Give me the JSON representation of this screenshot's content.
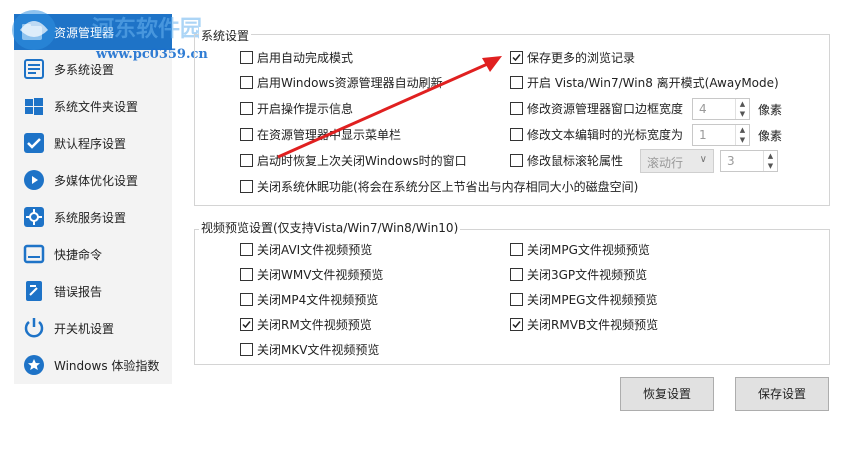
{
  "sidebar": {
    "items": [
      {
        "label": "资源管理器",
        "icon": "folder-icon"
      },
      {
        "label": "多系统设置",
        "icon": "multi-system-icon"
      },
      {
        "label": "系统文件夹设置",
        "icon": "windows-folder-icon"
      },
      {
        "label": "默认程序设置",
        "icon": "checkmark-icon"
      },
      {
        "label": "多媒体优化设置",
        "icon": "media-icon"
      },
      {
        "label": "系统服务设置",
        "icon": "service-icon"
      },
      {
        "label": "快捷命令",
        "icon": "shortcut-icon"
      },
      {
        "label": "错误报告",
        "icon": "error-report-icon"
      },
      {
        "label": "开关机设置",
        "icon": "power-icon"
      },
      {
        "label": "Windows 体验指数",
        "icon": "star-icon"
      }
    ]
  },
  "watermark": {
    "brand": "河东软件园",
    "url": "www.pc0359.cn"
  },
  "system_settings": {
    "title": "系统设置",
    "left_options": [
      {
        "label": "启用自动完成模式",
        "checked": false
      },
      {
        "label": "启用Windows资源管理器自动刷新",
        "checked": false
      },
      {
        "label": "开启操作提示信息",
        "checked": false
      },
      {
        "label": "在资源管理器中显示菜单栏",
        "checked": false
      },
      {
        "label": "启动时恢复上次关闭Windows时的窗口",
        "checked": false
      }
    ],
    "right_options": [
      {
        "label": "保存更多的浏览记录",
        "checked": true
      },
      {
        "label": "开启 Vista/Win7/Win8 离开模式(AwayMode)",
        "checked": false
      },
      {
        "label": "修改资源管理器窗口边框宽度",
        "checked": false
      },
      {
        "label": "修改文本编辑时的光标宽度为",
        "checked": false
      },
      {
        "label": "修改鼠标滚轮属性",
        "checked": false
      }
    ],
    "full_option": {
      "label": "关闭系统休眠功能(将会在系统分区上节省出与内存相同大小的磁盘空间)",
      "checked": false
    },
    "border_width": {
      "value": "4",
      "unit": "像素"
    },
    "cursor_width": {
      "value": "1",
      "unit": "像素"
    },
    "wheel_mode": {
      "value": "滚动行"
    },
    "wheel_lines": {
      "value": "3"
    }
  },
  "video_preview": {
    "title": "视频预览设置(仅支持Vista/Win7/Win8/Win10)",
    "left_options": [
      {
        "label": "关闭AVI文件视频预览",
        "checked": false
      },
      {
        "label": "关闭WMV文件视频预览",
        "checked": false
      },
      {
        "label": "关闭MP4文件视频预览",
        "checked": false
      },
      {
        "label": "关闭RM文件视频预览",
        "checked": true
      },
      {
        "label": "关闭MKV文件视频预览",
        "checked": false
      }
    ],
    "right_options": [
      {
        "label": "关闭MPG文件视频预览",
        "checked": false
      },
      {
        "label": "关闭3GP文件视频预览",
        "checked": false
      },
      {
        "label": "关闭MPEG文件视频预览",
        "checked": false
      },
      {
        "label": "关闭RMVB文件视频预览",
        "checked": true
      }
    ]
  },
  "buttons": {
    "restore": "恢复设置",
    "save": "保存设置"
  },
  "colors": {
    "sidebar_accent": "#1e73c7",
    "icon_blue": "#1e73c7",
    "annotation_arrow": "#e02020"
  }
}
